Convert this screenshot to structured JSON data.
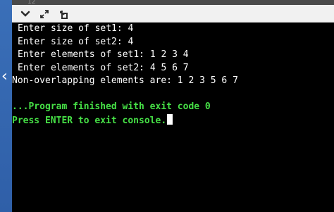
{
  "topbar": {
    "tab_number": "12",
    "icons": [
      "chevron-down-icon",
      "expand-icon",
      "share-icon"
    ]
  },
  "console": {
    "lines": [
      "Enter size of set1: 4",
      "Enter size of set2: 4",
      "Enter elements of set1: 1 2 3 4",
      "Enter elements of set2: 4 5 6 7",
      "Non-overlapping elements are: 1 2 3 5 6 7",
      "",
      "...Program finished with exit code 0",
      "Press ENTER to exit console."
    ]
  },
  "colors": {
    "console_bg": "#000000",
    "console_text": "#ffffff",
    "status_text": "#46e046",
    "side_strip": "#3a6fb8"
  }
}
